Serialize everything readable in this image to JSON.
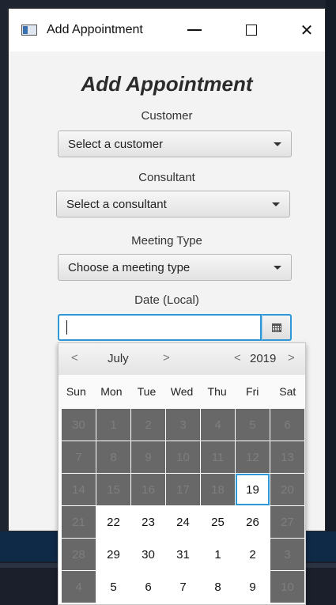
{
  "window": {
    "title": "Add Appointment"
  },
  "form": {
    "heading": "Add Appointment",
    "customer": {
      "label": "Customer",
      "value": "Select a customer"
    },
    "consultant": {
      "label": "Consultant",
      "value": "Select a consultant"
    },
    "meeting_type": {
      "label": "Meeting Type",
      "value": "Choose a meeting type"
    },
    "date": {
      "label": "Date (Local)",
      "value": ""
    }
  },
  "calendar": {
    "month": "July",
    "year": "2019",
    "prev_month": "<",
    "next_month": ">",
    "prev_year": "<",
    "next_year": ">",
    "weekdays": [
      "Sun",
      "Mon",
      "Tue",
      "Wed",
      "Thu",
      "Fri",
      "Sat"
    ],
    "weeks": [
      [
        {
          "d": "30",
          "disabled": true
        },
        {
          "d": "1",
          "disabled": true
        },
        {
          "d": "2",
          "disabled": true
        },
        {
          "d": "3",
          "disabled": true
        },
        {
          "d": "4",
          "disabled": true
        },
        {
          "d": "5",
          "disabled": true
        },
        {
          "d": "6",
          "disabled": true
        }
      ],
      [
        {
          "d": "7",
          "disabled": true
        },
        {
          "d": "8",
          "disabled": true
        },
        {
          "d": "9",
          "disabled": true
        },
        {
          "d": "10",
          "disabled": true
        },
        {
          "d": "11",
          "disabled": true
        },
        {
          "d": "12",
          "disabled": true
        },
        {
          "d": "13",
          "disabled": true
        }
      ],
      [
        {
          "d": "14",
          "disabled": true
        },
        {
          "d": "15",
          "disabled": true
        },
        {
          "d": "16",
          "disabled": true
        },
        {
          "d": "17",
          "disabled": true
        },
        {
          "d": "18",
          "disabled": true
        },
        {
          "d": "19",
          "disabled": false,
          "today": true
        },
        {
          "d": "20",
          "disabled": true
        }
      ],
      [
        {
          "d": "21",
          "disabled": true
        },
        {
          "d": "22",
          "disabled": false
        },
        {
          "d": "23",
          "disabled": false
        },
        {
          "d": "24",
          "disabled": false
        },
        {
          "d": "25",
          "disabled": false
        },
        {
          "d": "26",
          "disabled": false
        },
        {
          "d": "27",
          "disabled": true
        }
      ],
      [
        {
          "d": "28",
          "disabled": true
        },
        {
          "d": "29",
          "disabled": false
        },
        {
          "d": "30",
          "disabled": false
        },
        {
          "d": "31",
          "disabled": false
        },
        {
          "d": "1",
          "disabled": false
        },
        {
          "d": "2",
          "disabled": false
        },
        {
          "d": "3",
          "disabled": true
        }
      ],
      [
        {
          "d": "4",
          "disabled": true
        },
        {
          "d": "5",
          "disabled": false
        },
        {
          "d": "6",
          "disabled": false
        },
        {
          "d": "7",
          "disabled": false
        },
        {
          "d": "8",
          "disabled": false
        },
        {
          "d": "9",
          "disabled": false
        },
        {
          "d": "10",
          "disabled": true
        }
      ]
    ]
  },
  "colors": {
    "focus": "#2e98d6",
    "disabled_cell": "#686868"
  }
}
